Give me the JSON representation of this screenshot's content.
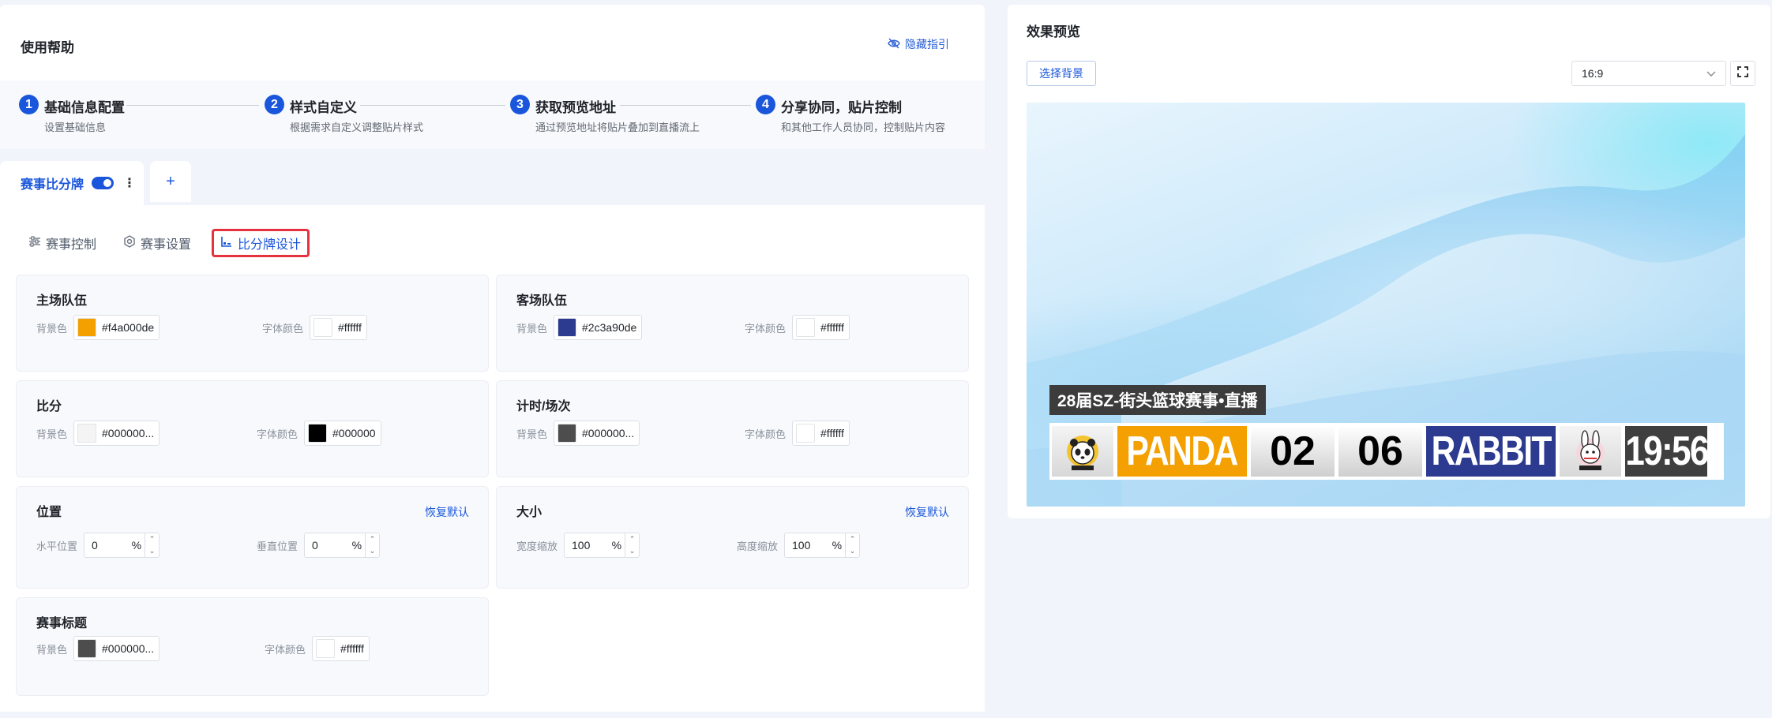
{
  "help": {
    "title": "使用帮助",
    "hide_guide": "隐藏指引",
    "steps": [
      {
        "num": "1",
        "title": "基础信息配置",
        "desc": "设置基础信息"
      },
      {
        "num": "2",
        "title": "样式自定义",
        "desc": "根据需求自定义调整贴片样式"
      },
      {
        "num": "3",
        "title": "获取预览地址",
        "desc": "通过预览地址将贴片叠加到直播流上"
      },
      {
        "num": "4",
        "title": "分享协同，贴片控制",
        "desc": "和其他工作人员协同，控制贴片内容"
      }
    ]
  },
  "tabs": {
    "page_tab_label": "赛事比分牌",
    "add_label": "+"
  },
  "sub_tabs": [
    {
      "label": "赛事控制",
      "icon": "sliders-icon"
    },
    {
      "label": "赛事设置",
      "icon": "gear-icon"
    },
    {
      "label": "比分牌设计",
      "icon": "design-icon"
    }
  ],
  "labels": {
    "bg": "背景色",
    "font": "字体颜色",
    "reset": "恢复默认",
    "h_pos": "水平位置",
    "v_pos": "垂直位置",
    "w_scale": "宽度缩放",
    "h_scale": "高度缩放",
    "pct": "%"
  },
  "cards": {
    "home": {
      "title": "主场队伍",
      "bg_value": "#f4a000de",
      "bg_swatch": "#f4a000",
      "font_value": "#ffffff",
      "font_swatch": "#ffffff"
    },
    "away": {
      "title": "客场队伍",
      "bg_value": "#2c3a90de",
      "bg_swatch": "#2c3a90",
      "font_value": "#ffffff",
      "font_swatch": "#ffffff"
    },
    "score": {
      "title": "比分",
      "bg_value": "#000000...",
      "bg_swatch": "#f4f4f4",
      "font_value": "#000000",
      "font_swatch": "#000000"
    },
    "timer": {
      "title": "计时/场次",
      "bg_value": "#000000...",
      "bg_swatch": "#4d4d4d",
      "font_value": "#ffffff",
      "font_swatch": "#ffffff"
    },
    "position": {
      "title": "位置",
      "h_value": "0",
      "v_value": "0"
    },
    "size": {
      "title": "大小",
      "w_value": "100",
      "h_value": "100"
    },
    "match_title": {
      "title": "赛事标题",
      "bg_value": "#000000...",
      "bg_swatch": "#4d4d4d",
      "font_value": "#ffffff",
      "font_swatch": "#ffffff"
    }
  },
  "preview": {
    "title": "效果预览",
    "choose_bg": "选择背景",
    "ratio": "16:9",
    "overlay_title": "28届SZ-街头篮球赛事•直播",
    "home_team": "PANDA",
    "home_score": "02",
    "away_score": "06",
    "away_team": "RABBIT",
    "timer": "19:56"
  }
}
